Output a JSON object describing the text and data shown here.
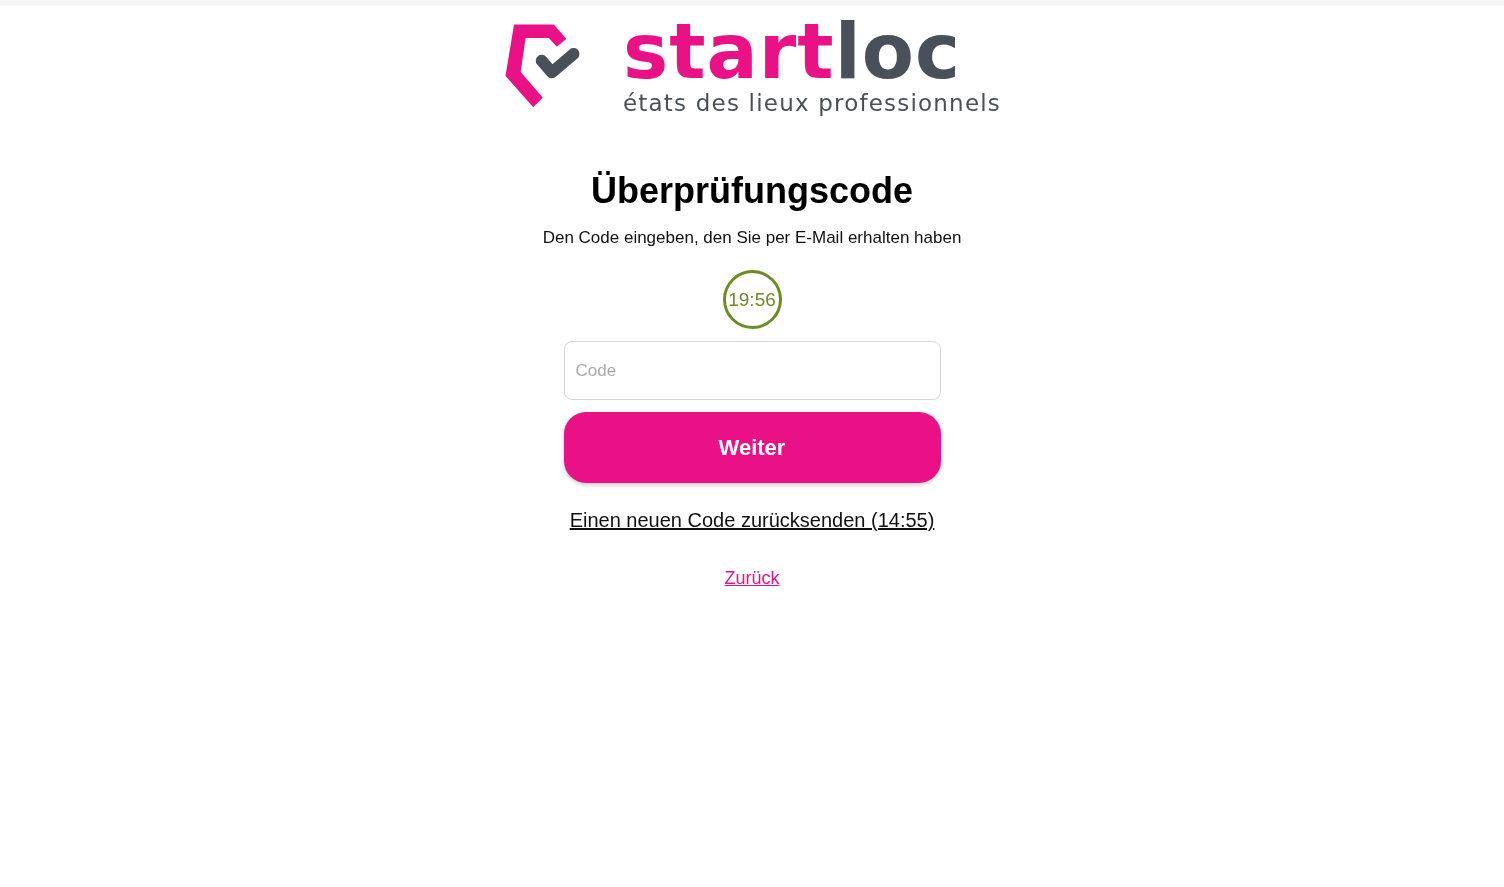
{
  "logo": {
    "brand_part_1": "start",
    "brand_part_2": "loc",
    "tagline": "états des lieux professionnels"
  },
  "heading": "Überprüfungscode",
  "instruction": "Den Code eingeben, den Sie per E-Mail erhalten haben",
  "timer": "19:56",
  "code_field": {
    "placeholder": "Code"
  },
  "submit_button": "Weiter",
  "resend_link": "Einen neuen Code zurücksenden (14:55)",
  "back_link": "Zurück"
}
